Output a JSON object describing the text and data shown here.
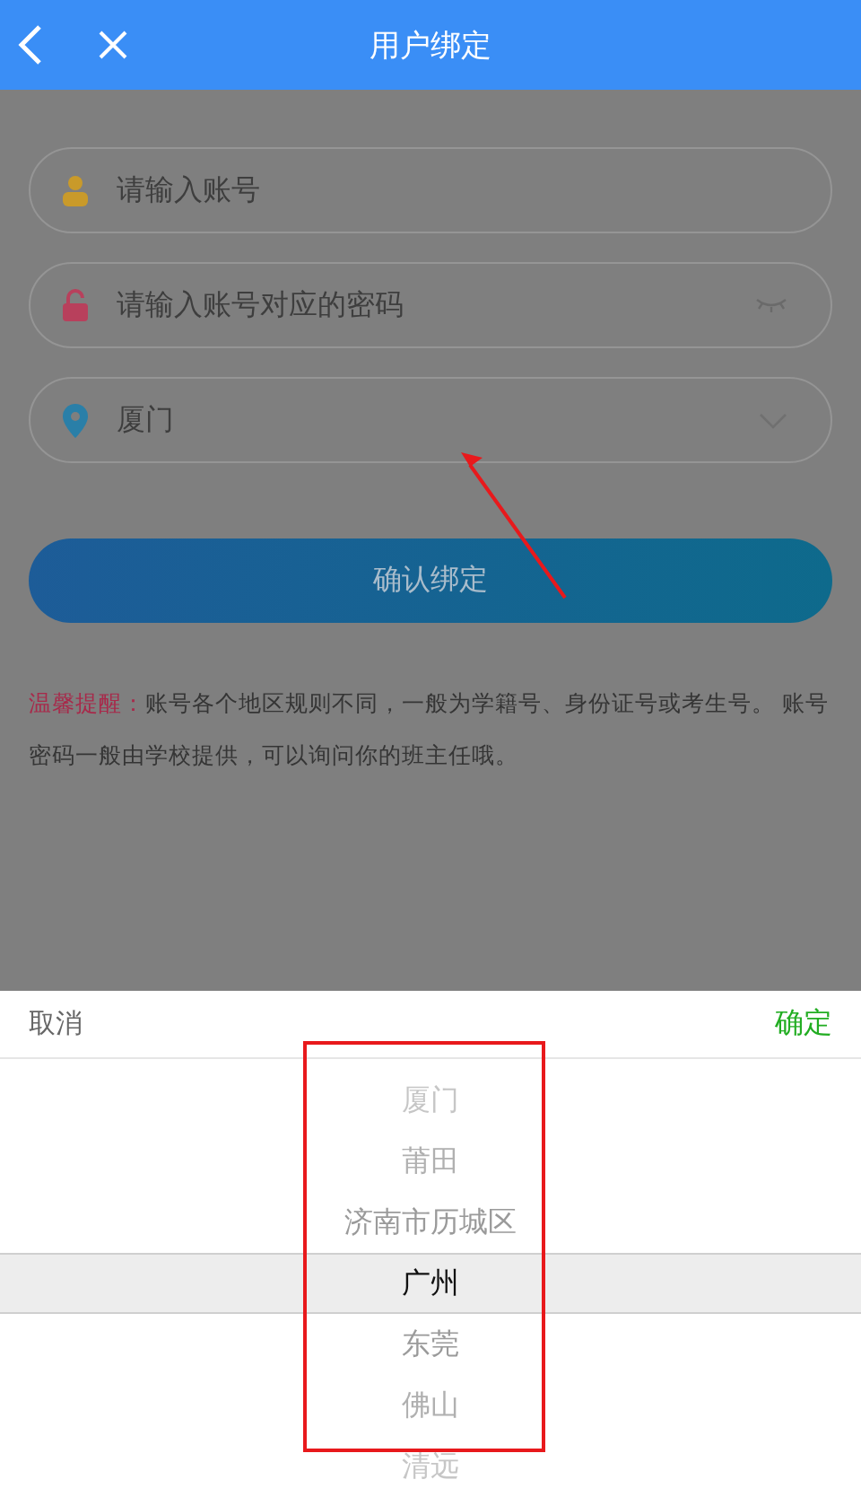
{
  "header": {
    "title": "用户绑定"
  },
  "form": {
    "fields": [
      {
        "kind": "account",
        "placeholder": "请输入账号"
      },
      {
        "kind": "password",
        "placeholder": "请输入账号对应的密码"
      },
      {
        "kind": "region",
        "value": "厦门"
      }
    ],
    "submit": "确认绑定",
    "tip": {
      "label": "温馨提醒：",
      "text": "账号各个地区规则不同，一般为学籍号、身份证号或考生号。 账号密码一般由学校提供，可以询问你的班主任哦。"
    }
  },
  "picker": {
    "cancel": "取消",
    "confirm": "确定",
    "options": [
      {
        "label": "厦门",
        "selected": false
      },
      {
        "label": "莆田",
        "selected": false
      },
      {
        "label": "济南市历城区",
        "selected": false
      },
      {
        "label": "广州",
        "selected": true
      },
      {
        "label": "东莞",
        "selected": false
      },
      {
        "label": "佛山",
        "selected": false
      },
      {
        "label": "清远",
        "selected": false
      }
    ]
  }
}
